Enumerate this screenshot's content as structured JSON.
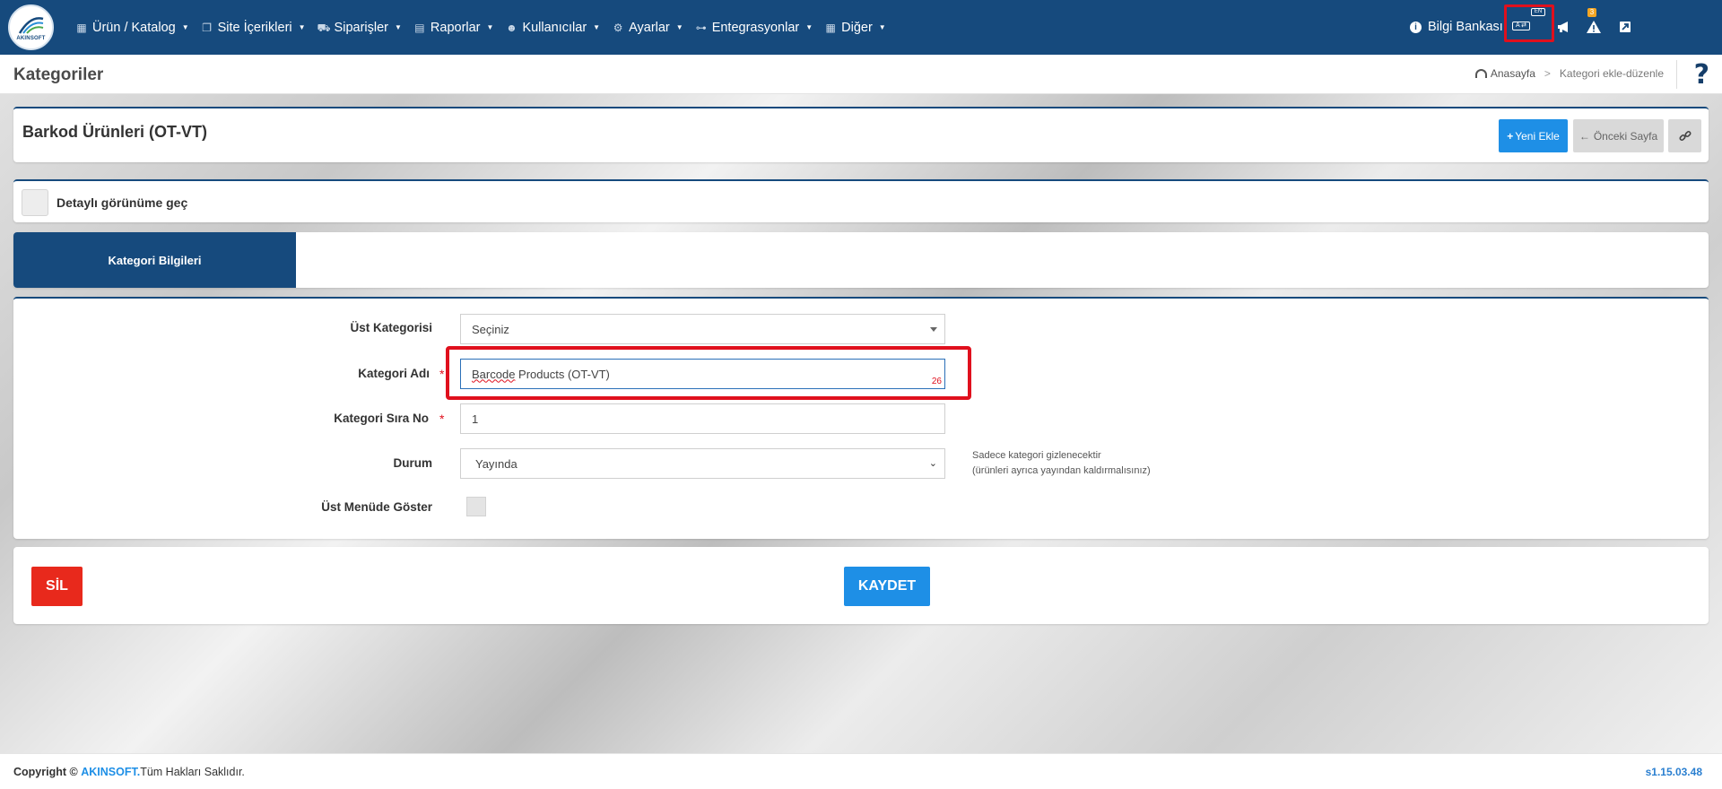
{
  "topnav": {
    "logo_text": "AKINSOFT",
    "menu": [
      {
        "label": "Ürün / Katalog",
        "icon": "boxes-icon"
      },
      {
        "label": "Site İçerikleri",
        "icon": "documents-icon"
      },
      {
        "label": "Siparişler",
        "icon": "cart-icon"
      },
      {
        "label": "Raporlar",
        "icon": "report-icon"
      },
      {
        "label": "Kullanıcılar",
        "icon": "users-icon"
      },
      {
        "label": "Ayarlar",
        "icon": "gears-icon"
      },
      {
        "label": "Entegrasyonlar",
        "icon": "sitemap-icon"
      },
      {
        "label": "Diğer",
        "icon": "grid-icon"
      }
    ],
    "help_label": "Bilgi Bankası",
    "language_chip": "EN",
    "keyboard_label": "A ⇄",
    "alert_count": "3"
  },
  "page": {
    "title": "Kategoriler",
    "breadcrumb": {
      "home": "Anasayfa",
      "current": "Kategori ekle-düzenle"
    },
    "help_symbol": "?"
  },
  "record": {
    "title": "Barkod Ürünleri (OT-VT)",
    "new_button": "Yeni Ekle",
    "prev_button": "Önceki Sayfa"
  },
  "detail_toggle": {
    "label": "Detaylı görünüme geç"
  },
  "tabs": [
    {
      "label": "Kategori Bilgileri",
      "active": true
    }
  ],
  "form": {
    "parent_category": {
      "label": "Üst Kategorisi",
      "value": "Seçiniz"
    },
    "category_name": {
      "label": "Kategori Adı",
      "value_word": "Barcode",
      "value_rest": " Products (OT-VT)",
      "counter": "26"
    },
    "sort_no": {
      "label": "Kategori Sıra No",
      "value": "1"
    },
    "status": {
      "label": "Durum",
      "value": "Yayında",
      "hint_line1": "Sadece kategori gizlenecektir",
      "hint_line2": "(ürünleri ayrıca yayından kaldırmalısınız)"
    },
    "top_menu": {
      "label": "Üst Menüde Göster"
    },
    "required_mark": "*"
  },
  "actions": {
    "delete": "SİL",
    "save": "KAYDET"
  },
  "footer": {
    "copyright_prefix": "Copyright ©",
    "brand": "AKINSOFT.",
    "rights": "Tüm Hakları Saklıdır.",
    "version": "s1.15.03.48"
  },
  "colors": {
    "primary": "#164a7d",
    "accent_blue": "#1e8fe6",
    "danger": "#e8291c",
    "highlight": "#e0101d"
  }
}
